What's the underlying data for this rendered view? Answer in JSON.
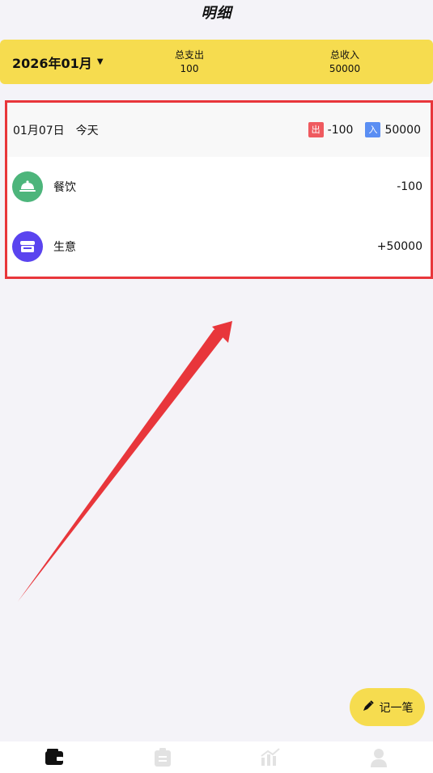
{
  "header": {
    "title": "明细"
  },
  "summary": {
    "month": "2026年01月",
    "expense_label": "总支出",
    "expense_value": "100",
    "income_label": "总收入",
    "income_value": "50000"
  },
  "day": {
    "date": "01月07日",
    "weekday": "今天",
    "out_tag": "出",
    "out_total": "-100",
    "in_tag": "入",
    "in_total": "50000",
    "items": [
      {
        "icon": "food-cloche-icon",
        "category": "餐饮",
        "amount": "-100"
      },
      {
        "icon": "shop-icon",
        "category": "生意",
        "amount": "+50000"
      }
    ]
  },
  "fab": {
    "icon": "pen-icon",
    "label": "记一笔"
  },
  "tabbar": {
    "tabs": [
      {
        "icon": "wallet-icon",
        "active": true
      },
      {
        "icon": "clipboard-icon",
        "active": false
      },
      {
        "icon": "chart-icon",
        "active": false
      },
      {
        "icon": "user-icon",
        "active": false
      }
    ]
  },
  "colors": {
    "accent_yellow": "#f6dc4f",
    "highlight_red": "#e8363b",
    "expense_tag": "#ef5a5f",
    "income_tag": "#5a8ef3",
    "food_icon_bg": "#4db57b",
    "business_icon_bg": "#5a44ef"
  }
}
